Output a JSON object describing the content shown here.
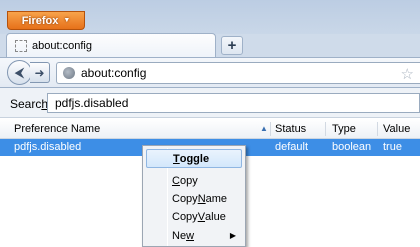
{
  "browser": {
    "menu_button": "Firefox",
    "tab_title": "about:config",
    "url": "about:config",
    "new_tab": "+"
  },
  "search": {
    "label_prefix": "Searc",
    "label_access": "h",
    "label_suffix": ":",
    "value": "pdfjs.disabled"
  },
  "table": {
    "columns": [
      "Preference Name",
      "Status",
      "Type",
      "Value"
    ],
    "rows": [
      {
        "name": "pdfjs.disabled",
        "status": "default",
        "type": "boolean",
        "value": "true"
      }
    ]
  },
  "context_menu": {
    "toggle": {
      "pre": "",
      "key": "T",
      "post": "oggle"
    },
    "copy": {
      "pre": "",
      "key": "C",
      "post": "opy"
    },
    "copy_name": {
      "pre": "Copy ",
      "key": "N",
      "post": "ame"
    },
    "copy_value": {
      "pre": "Copy ",
      "key": "V",
      "post": "alue"
    },
    "new": {
      "pre": "Ne",
      "key": "w",
      "post": ""
    }
  }
}
